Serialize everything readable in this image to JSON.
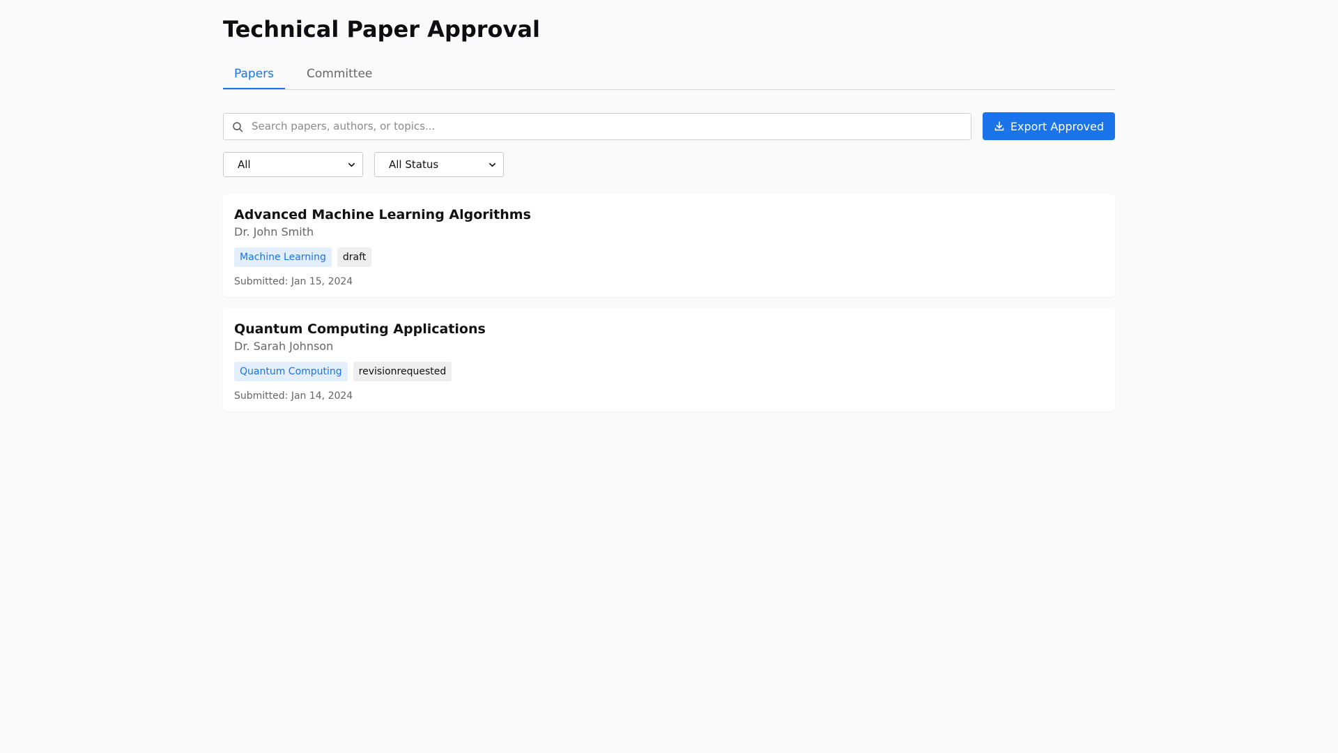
{
  "page": {
    "title": "Technical Paper Approval"
  },
  "tabs": [
    {
      "label": "Papers",
      "active": true
    },
    {
      "label": "Committee",
      "active": false
    }
  ],
  "search": {
    "placeholder": "Search papers, authors, or topics...",
    "value": "",
    "icon": "search-icon"
  },
  "toolbar": {
    "export_label": "Export Approved",
    "export_icon": "download-icon"
  },
  "filters": {
    "type_selected": "All",
    "status_selected": "All Status"
  },
  "papers": [
    {
      "title": "Advanced Machine Learning Algorithms",
      "author": "Dr. John Smith",
      "topic": "Machine Learning",
      "status": "draft",
      "submitted": "Submitted: Jan 15, 2024"
    },
    {
      "title": "Quantum Computing Applications",
      "author": "Dr. Sarah Johnson",
      "topic": "Quantum Computing",
      "status": "revisionrequested",
      "submitted": "Submitted: Jan 14, 2024"
    }
  ],
  "colors": {
    "accent": "#1a73e8",
    "background": "#fafafa",
    "topic_badge_bg": "#e3effd",
    "status_badge_bg": "#eeeeee"
  }
}
